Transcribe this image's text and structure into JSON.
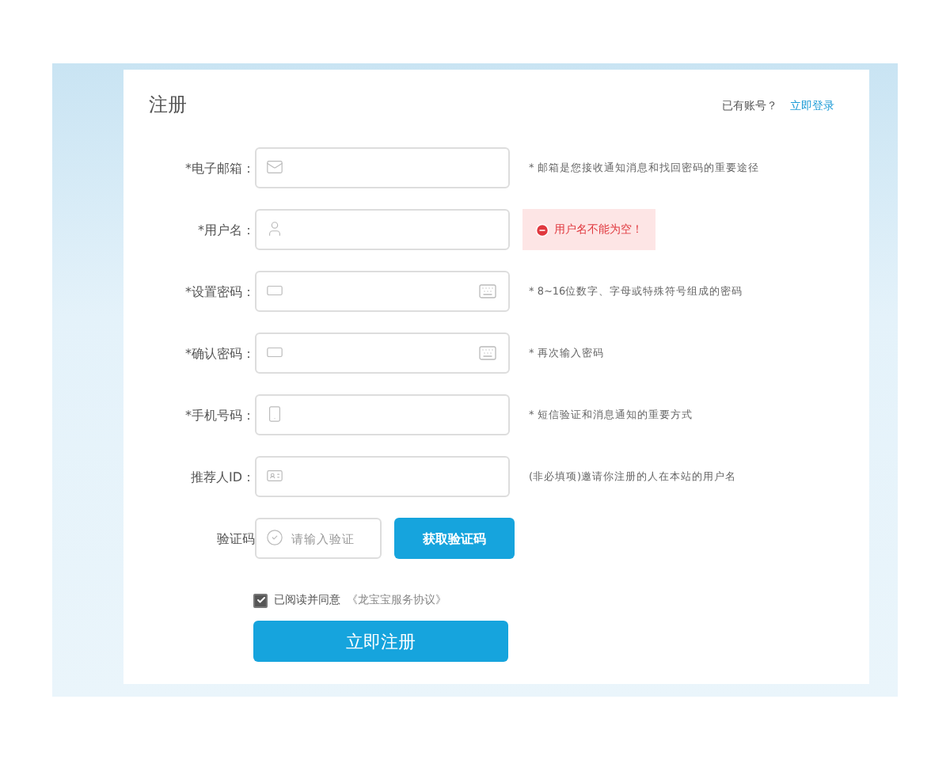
{
  "title": "注册",
  "login_prompt": {
    "text": "已有账号？",
    "link": "立即登录"
  },
  "fields": [
    {
      "label": "*电子邮箱：",
      "kind": "email",
      "hint": {
        "kind": "note",
        "text": "* 邮箱是您接收通知消息和找回密码的重要途径"
      }
    },
    {
      "label": "*用户名：",
      "kind": "username",
      "hint": {
        "kind": "error",
        "text": "用户名不能为空！"
      }
    },
    {
      "label": "*设置密码：",
      "kind": "password",
      "hint": {
        "kind": "note",
        "text": "* 8~16位数字、字母或特殊符号组成的密码"
      }
    },
    {
      "label": "*确认密码：",
      "kind": "password",
      "hint": {
        "kind": "note",
        "text": "* 再次输入密码"
      }
    },
    {
      "label": "*手机号码：",
      "kind": "phone",
      "hint": {
        "kind": "note",
        "text": "* 短信验证和消息通知的重要方式"
      }
    },
    {
      "label": "推荐人ID：",
      "kind": "referrer",
      "hint": {
        "kind": "note",
        "text": "(非必填项)邀请你注册的人在本站的用户名"
      }
    }
  ],
  "captcha": {
    "label": "验证码",
    "placeholder": "请输入验证",
    "button": "获取验证码"
  },
  "agreement": {
    "checked": true,
    "text": "已阅读并同意",
    "link": "《龙宝宝服务协议》"
  },
  "submit": "立即注册"
}
